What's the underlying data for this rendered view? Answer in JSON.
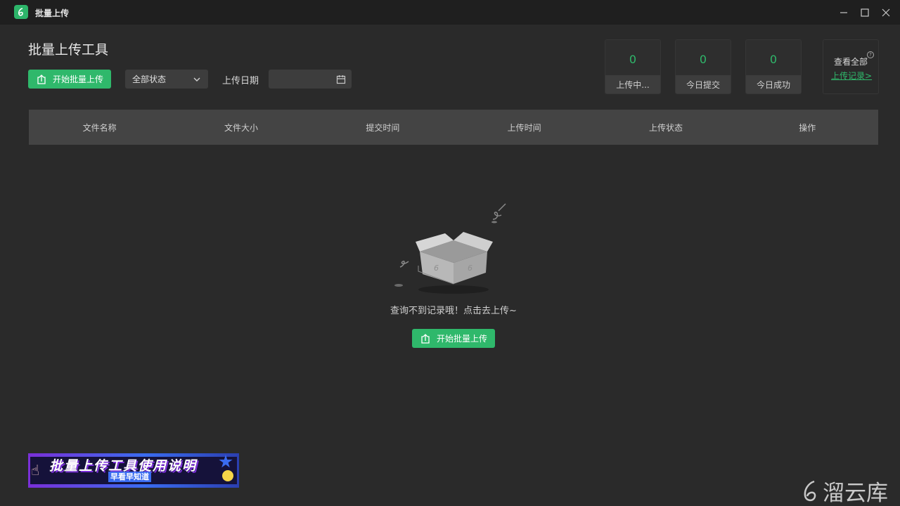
{
  "window": {
    "title": "批量上传"
  },
  "page": {
    "title": "批量上传工具"
  },
  "toolbar": {
    "start_button": "开始批量上传",
    "status_filter": "全部状态",
    "date_label": "上传日期",
    "date_value": ""
  },
  "stats": [
    {
      "value": "0",
      "label": "上传中..."
    },
    {
      "value": "0",
      "label": "今日提交"
    },
    {
      "value": "0",
      "label": "今日成功"
    }
  ],
  "history": {
    "title": "查看全部",
    "link": "上传记录>"
  },
  "table": {
    "columns": [
      "文件名称",
      "文件大小",
      "提交时间",
      "上传时间",
      "上传状态",
      "操作"
    ]
  },
  "empty": {
    "message": "查询不到记录哦！点击去上传~",
    "button": "开始批量上传"
  },
  "banner": {
    "title": "批量上传工具使用说明",
    "subtitle": "早看早知道"
  },
  "watermark": {
    "text": "溜云库"
  },
  "colors": {
    "accent": "#2fb86b",
    "background": "#2a2a2a",
    "titlebar": "#1f1f1f"
  }
}
